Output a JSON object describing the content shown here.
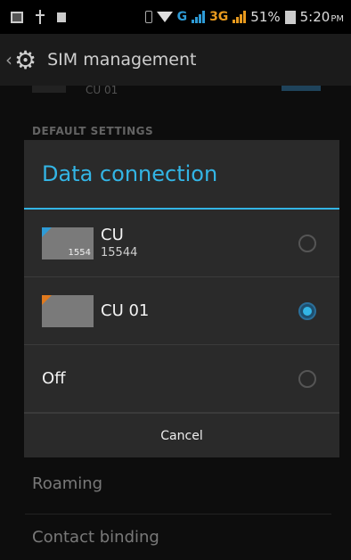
{
  "status_bar": {
    "network_g": "G",
    "network_3g": "3G",
    "battery": "51%",
    "time": "5:20",
    "ampm": "PM"
  },
  "action_bar": {
    "title": "SIM management"
  },
  "settings": {
    "partial_item": "CU 01",
    "section_header": "DEFAULT SETTINGS",
    "roaming": "Roaming",
    "contact_binding": "Contact binding"
  },
  "dialog": {
    "title": "Data connection",
    "options": [
      {
        "label": "CU",
        "sub": "15544",
        "sim_number": "1554",
        "color": "#2e9bd6",
        "selected": false
      },
      {
        "label": "CU 01",
        "sub": "",
        "sim_number": "",
        "color": "#e07a1e",
        "selected": true
      },
      {
        "label": "Off",
        "selected": false
      }
    ],
    "cancel": "Cancel"
  },
  "colors": {
    "accent": "#33b5e5",
    "background": "#0e0e0e",
    "dialog_bg": "#2a2a2a"
  }
}
